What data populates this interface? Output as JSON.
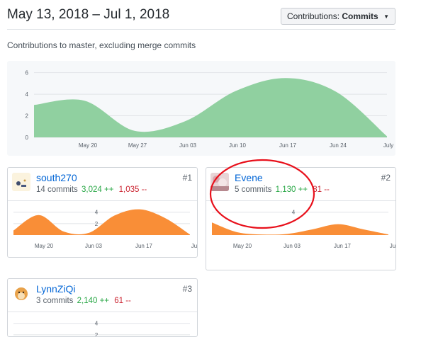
{
  "header": {
    "date_range": "May 13, 2018 – Jul 1, 2018",
    "contrib_label": "Contributions:",
    "contrib_value": "Commits"
  },
  "subtitle": "Contributions to master, excluding merge commits",
  "colors": {
    "main_fill": "#90d0a0",
    "user_fill": "#f98e37",
    "link": "#0366d6",
    "add": "#28a745",
    "del": "#cb2431",
    "annotation": "#e8101b"
  },
  "chart_data": [
    {
      "type": "area",
      "x": [
        "May 13",
        "May 20",
        "May 27",
        "Jun 03",
        "Jun 10",
        "Jun 17",
        "Jun 24",
        "Jul 1"
      ],
      "values": [
        3.0,
        3.4,
        0.6,
        1.5,
        4.3,
        5.5,
        4.2,
        0.1
      ],
      "yticks": [
        "0",
        "2",
        "4",
        "6"
      ],
      "xticks": [
        "May 20",
        "May 27",
        "Jun 03",
        "Jun 10",
        "Jun 17",
        "Jun 24",
        "July"
      ],
      "ylim": [
        0,
        6.5
      ]
    },
    {
      "type": "area",
      "x": [
        "May 13",
        "May 20",
        "May 27",
        "Jun 03",
        "Jun 10",
        "Jun 17",
        "Jun 24",
        "Jul 1"
      ],
      "values": [
        0.8,
        3.5,
        0.6,
        0.4,
        3.4,
        4.5,
        3.0,
        0.1
      ],
      "yticks": [
        "2",
        "4"
      ],
      "xticks": [
        "May 20",
        "Jun 03",
        "Jun 17",
        "Ju"
      ],
      "ylim": [
        0,
        5.2
      ]
    },
    {
      "type": "area",
      "x": [
        "May 13",
        "May 20",
        "May 27",
        "Jun 03",
        "Jun 10",
        "Jun 17",
        "Jun 24",
        "Jul 1"
      ],
      "values": [
        2.2,
        0.5,
        0.1,
        0.2,
        1.0,
        1.9,
        1.0,
        0.1
      ],
      "yticks": [
        "4"
      ],
      "xticks": [
        "May 20",
        "Jun 03",
        "Jun 17",
        "Ju"
      ],
      "ylim": [
        0,
        5.2
      ]
    },
    {
      "type": "area",
      "x": [],
      "values": [],
      "yticks": [
        "4",
        "2"
      ],
      "xticks": [],
      "ylim": [
        0,
        5.2
      ]
    }
  ],
  "contributors": [
    {
      "name": "south270",
      "commits": "14 commits",
      "adds": "3,024 ++",
      "dels": "1,035 --",
      "rank": "#1"
    },
    {
      "name": "Evene",
      "commits": "5 commits",
      "adds": "1,130 ++",
      "dels": "81 --",
      "rank": "#2"
    },
    {
      "name": "LynnZiQi",
      "commits": "3 commits",
      "adds": "2,140 ++",
      "dels": "61 --",
      "rank": "#3"
    }
  ]
}
